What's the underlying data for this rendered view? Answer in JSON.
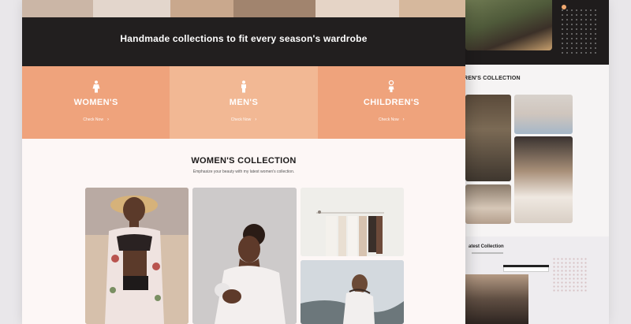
{
  "banner": {
    "title": "Handmade collections to fit every season's wardrobe"
  },
  "categories": [
    {
      "label": "WOMEN'S",
      "link": "Check Now",
      "icon": "woman-icon"
    },
    {
      "label": "MEN'S",
      "link": "Check Now",
      "icon": "man-icon"
    },
    {
      "label": "CHILDREN'S",
      "link": "Check Now",
      "icon": "child-icon"
    }
  ],
  "collection": {
    "title": "WOMEN'S COLLECTION",
    "subtitle": "Emphasize your beauty with my latest women's collection."
  },
  "secondary_page": {
    "collection_heading": "REN'S COLLECTION",
    "latest_heading": "atest Collection"
  },
  "colors": {
    "banner": "#221f1f",
    "category_orange": "#efa37c",
    "category_light": "#f2b894",
    "page_bg": "#fdf7f6"
  }
}
